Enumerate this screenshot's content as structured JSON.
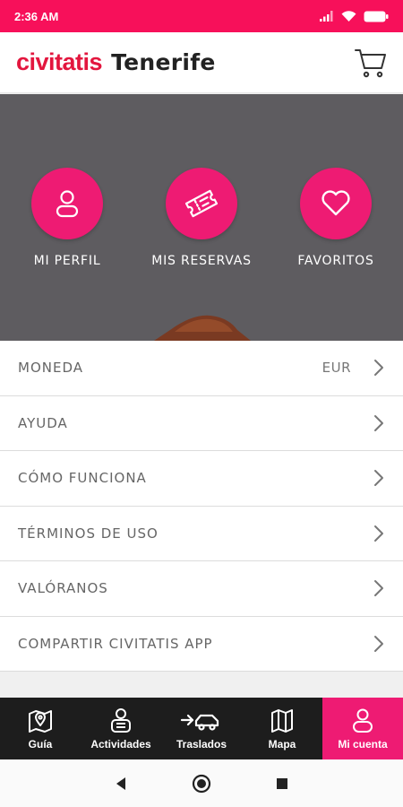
{
  "status_bar": {
    "time": "2:36 AM"
  },
  "header": {
    "logo": "civitatis",
    "city": "Tenerife"
  },
  "hero": {
    "items": [
      {
        "label": "MI PERFIL",
        "icon": "person-icon"
      },
      {
        "label": "MIS RESERVAS",
        "icon": "ticket-icon"
      },
      {
        "label": "FAVORITOS",
        "icon": "heart-icon"
      }
    ]
  },
  "menu": {
    "items": [
      {
        "label": "MONEDA",
        "value": "EUR"
      },
      {
        "label": "AYUDA"
      },
      {
        "label": "CÓMO FUNCIONA"
      },
      {
        "label": "TÉRMINOS DE USO"
      },
      {
        "label": "VALÓRANOS"
      },
      {
        "label": "COMPARTIR CIVITATIS APP"
      }
    ]
  },
  "bottom_nav": {
    "items": [
      {
        "label": "Guía",
        "icon": "map-pin-icon"
      },
      {
        "label": "Actividades",
        "icon": "guide-person-icon"
      },
      {
        "label": "Traslados",
        "icon": "car-transfer-icon"
      },
      {
        "label": "Mapa",
        "icon": "map-icon"
      },
      {
        "label": "Mi cuenta",
        "icon": "account-icon",
        "active": true
      }
    ]
  },
  "colors": {
    "accent": "#ee1b73",
    "status_bar": "#f7105a",
    "brand_red": "#e3163e",
    "hero_bg": "#5e5c60",
    "nav_bg": "#1d1d1d"
  }
}
